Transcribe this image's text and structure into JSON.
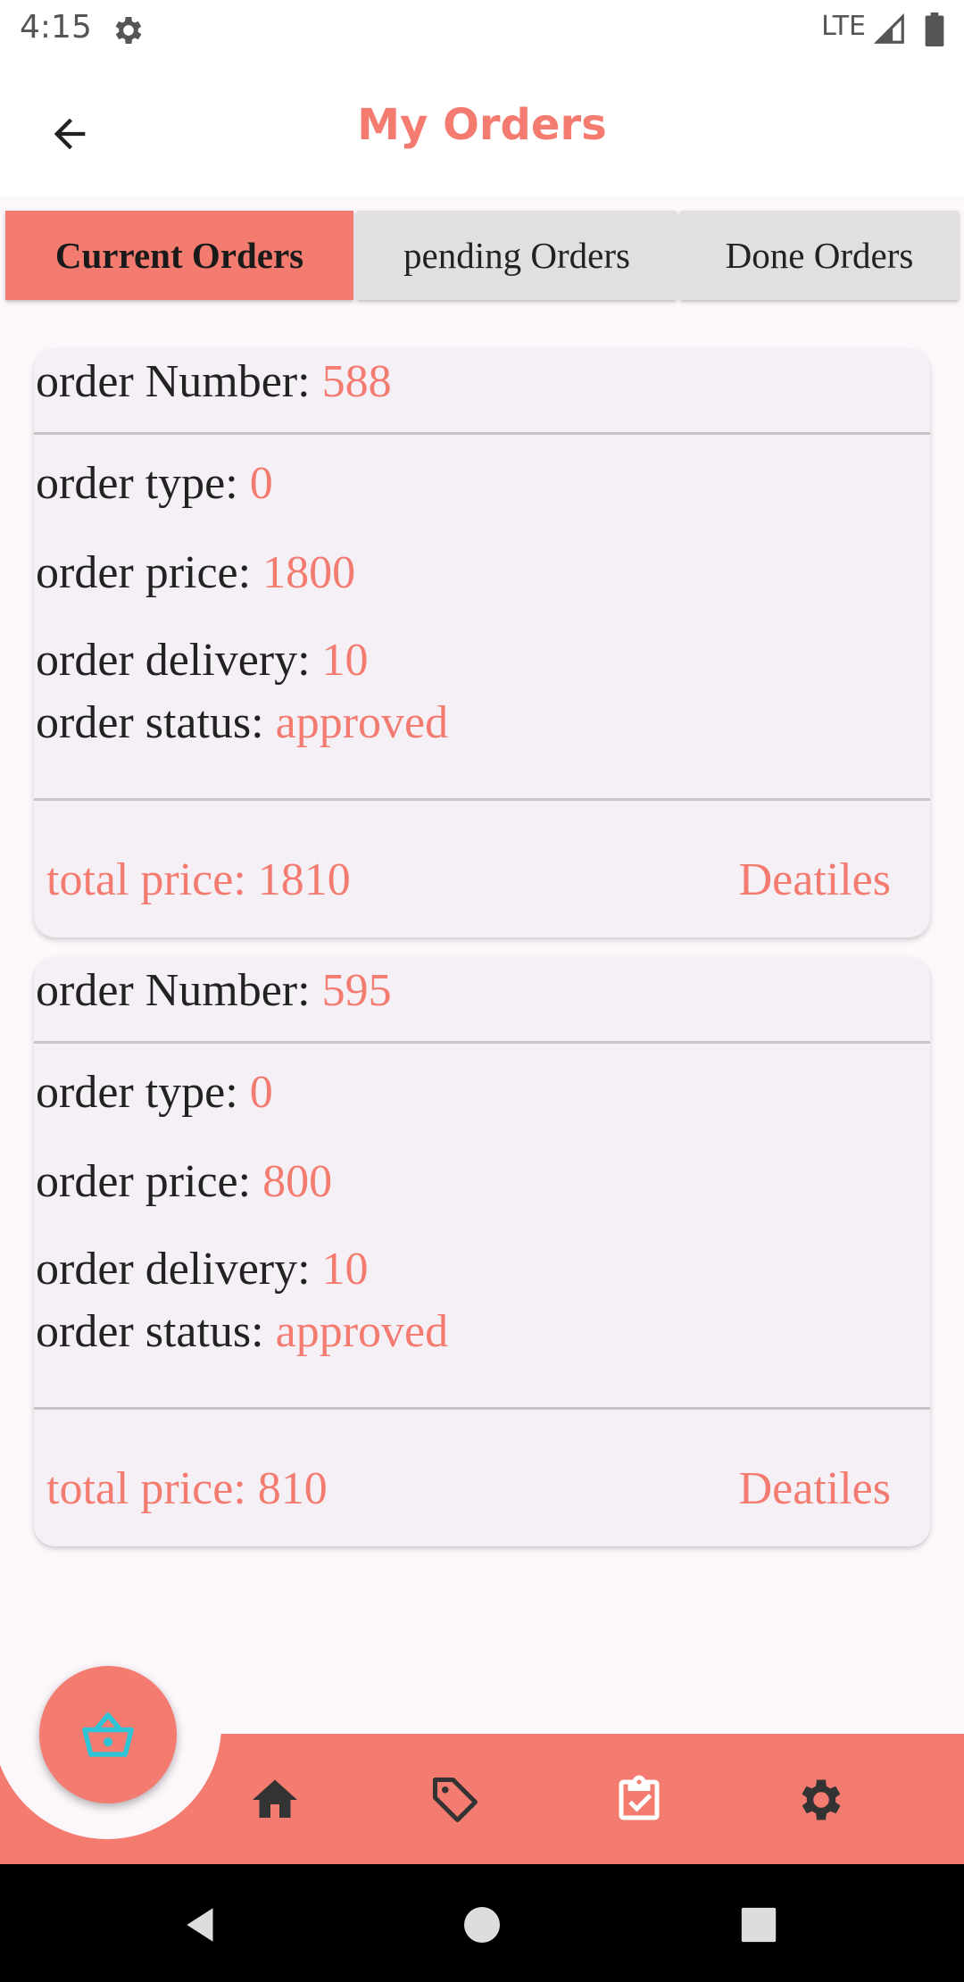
{
  "status_bar": {
    "time": "4:15",
    "network": "LTE"
  },
  "app_bar": {
    "title": "My Orders"
  },
  "tabs": [
    {
      "label": "Current Orders",
      "active": true
    },
    {
      "label": "pending Orders",
      "active": false
    },
    {
      "label": "Done Orders",
      "active": false
    }
  ],
  "orders": [
    {
      "number_label": "order Number: ",
      "number": "588",
      "type_label": "order type: ",
      "type": "0",
      "price_label": "order price: ",
      "price": "1800",
      "delivery_label": "order delivery: ",
      "delivery": "10",
      "status_label": "order status: ",
      "status": "approved",
      "total": "total price: 1810",
      "details_label": "Deatiles"
    },
    {
      "number_label": "order Number: ",
      "number": "595",
      "type_label": "order type: ",
      "type": "0",
      "price_label": "order price: ",
      "price": "800",
      "delivery_label": "order delivery: ",
      "delivery": "10",
      "status_label": "order status: ",
      "status": "approved",
      "total": "total price: 810",
      "details_label": "Deatiles"
    }
  ],
  "bottom_nav": {
    "fab_icon": "basket-icon",
    "items": [
      "home-icon",
      "tag-icon",
      "clipboard-check-icon",
      "gear-icon"
    ]
  },
  "colors": {
    "accent": "#f37b70",
    "fab_icon": "#2ec4d6",
    "background": "#fcf7fb"
  }
}
